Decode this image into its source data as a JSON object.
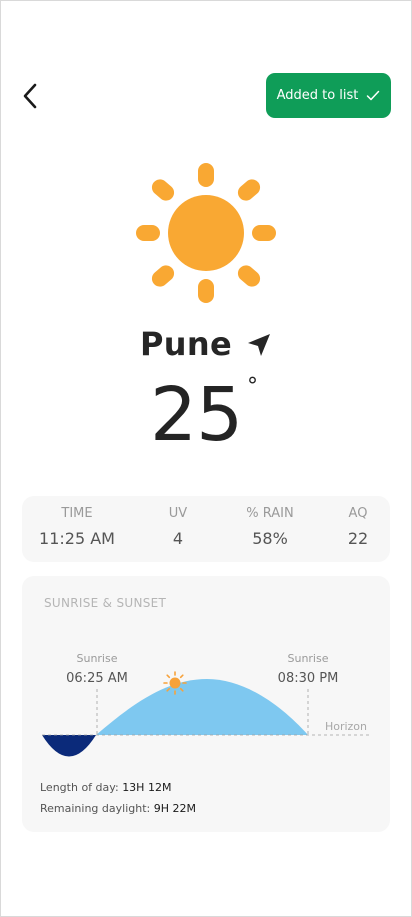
{
  "header": {
    "back_icon": "chevron-left-icon",
    "added_label": "Added to list",
    "added_icon": "check-icon",
    "accent_color": "#0f9d58"
  },
  "weather": {
    "icon": "sun-icon",
    "icon_color": "#f9a833",
    "city": "Pune",
    "location_icon": "navigation-arrow-icon",
    "temperature": "25",
    "degree_symbol": "°"
  },
  "stats": [
    {
      "label": "TIME",
      "value": "11:25 AM"
    },
    {
      "label": "UV",
      "value": "4"
    },
    {
      "label": "% RAIN",
      "value": "58%"
    },
    {
      "label": "AQ",
      "value": "22"
    }
  ],
  "sun_card": {
    "title": "SUNRISE & SUNSET",
    "sunrise_label": "Sunrise",
    "sunrise_time": "06:25 AM",
    "sunset_label": "Sunrise",
    "sunset_time": "08:30 PM",
    "horizon_label": "Horizon",
    "length_label": "Length of day:",
    "length_value": "13H 12M",
    "remaining_label": "Remaining daylight:",
    "remaining_value": "9H 22M",
    "day_color": "#7ec8f0",
    "night_color": "#0b2a7a"
  }
}
